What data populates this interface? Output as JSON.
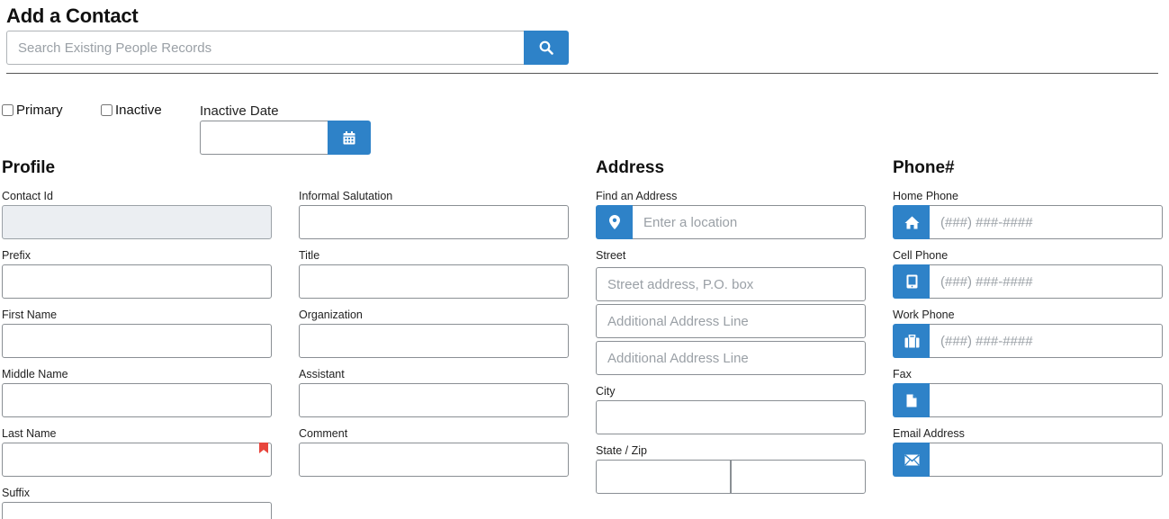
{
  "page": {
    "title": "Add a Contact"
  },
  "search": {
    "placeholder": "Search Existing People Records",
    "button_icon": "search-icon"
  },
  "flags": {
    "primary_label": "Primary",
    "inactive_label": "Inactive",
    "inactive_date_label": "Inactive Date",
    "inactive_date_value": ""
  },
  "profile": {
    "title": "Profile",
    "contact_id_label": "Contact Id",
    "prefix_label": "Prefix",
    "first_name_label": "First Name",
    "middle_name_label": "Middle Name",
    "last_name_label": "Last Name",
    "suffix_label": "Suffix",
    "informal_salutation_label": "Informal Salutation",
    "title_label": "Title",
    "organization_label": "Organization",
    "assistant_label": "Assistant",
    "comment_label": "Comment"
  },
  "address": {
    "title": "Address",
    "find_label": "Find an Address",
    "find_placeholder": "Enter a location",
    "street_label": "Street",
    "street_placeholder": "Street address, P.O. box",
    "additional1_placeholder": "Additional Address Line",
    "additional2_placeholder": "Additional Address Line",
    "city_label": "City",
    "state_zip_label": "State / Zip"
  },
  "phone": {
    "title": "Phone#",
    "home_label": "Home Phone",
    "home_placeholder": "(###) ###-####",
    "cell_label": "Cell Phone",
    "cell_placeholder": "(###) ###-####",
    "work_label": "Work Phone",
    "work_placeholder": "(###) ###-####",
    "fax_label": "Fax",
    "email_label": "Email Address"
  },
  "colors": {
    "accent": "#2e82c8",
    "required_flag": "#e8453c",
    "disabled_bg": "#ebeef2"
  }
}
